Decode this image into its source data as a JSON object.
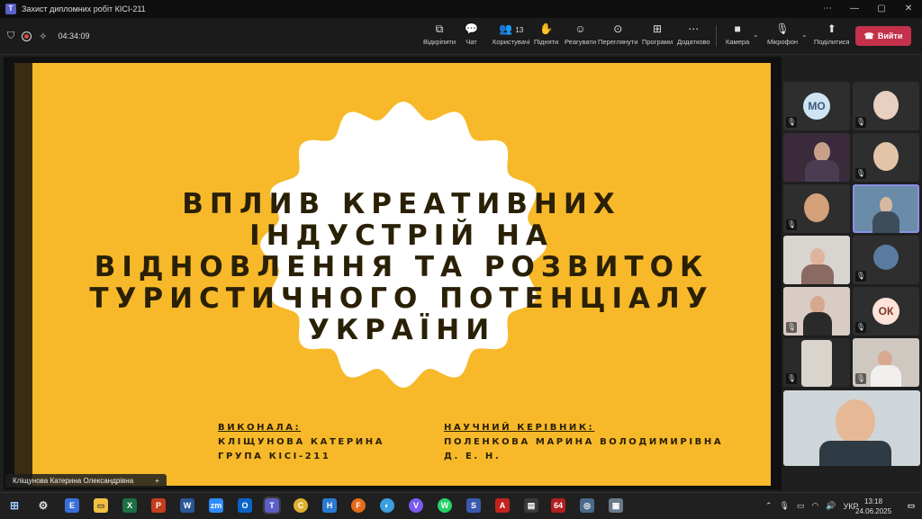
{
  "window": {
    "title": "Захист дипломних робіт КІСІ-211",
    "controls": [
      "⋯",
      "—",
      "▢",
      "✕"
    ]
  },
  "toolbar": {
    "timer": "04:34:09",
    "items": [
      {
        "label": "Відкріпити",
        "icon": "unpin-icon",
        "glyph": "⧉"
      },
      {
        "label": "Чат",
        "icon": "chat-icon",
        "glyph": "💬"
      },
      {
        "label": "Користувачі",
        "icon": "people-icon",
        "glyph": "👥",
        "count": "13"
      },
      {
        "label": "Підняти",
        "icon": "raise-hand-icon",
        "glyph": "✋"
      },
      {
        "label": "Реагувати",
        "icon": "react-icon",
        "glyph": "☺"
      },
      {
        "label": "Переглянути",
        "icon": "view-icon",
        "glyph": "⊙"
      },
      {
        "label": "Програми",
        "icon": "apps-icon",
        "glyph": "⊞"
      },
      {
        "label": "Додатково",
        "icon": "more-icon",
        "glyph": "⋯"
      }
    ],
    "camera_label": "Камера",
    "mic_label": "Мікрофон",
    "share_label": "Поділитися",
    "leave_label": "Вийти"
  },
  "slide": {
    "title_lines": [
      "ВПЛИВ КРЕАТИВНИХ",
      "ІНДУСТРІЙ НА",
      "ВІДНОВЛЕННЯ ТА РОЗВИТОК",
      "ТУРИСТИЧНОГО ПОТЕНЦІАЛУ",
      "УКРАЇНИ"
    ],
    "author_heading": "ВИКОНАЛА:",
    "author_name": "КЛІЩУНОВА КАТЕРИНА",
    "author_group": "ГРУПА КІСІ-211",
    "advisor_heading": "НАУЧНИЙ КЕРІВНИК:",
    "advisor_name": "ПОЛЕНКОВА МАРИНА ВОЛОДИМИРІВНА",
    "advisor_degree": "Д. Е. Н.",
    "bg_color": "#f7b92a"
  },
  "presenter": {
    "name": "Кліщунова Катерина Олександрівна",
    "pin": "+"
  },
  "participants": [
    {
      "initials": "МО",
      "avatar_color": "#cfe4f2",
      "text_color": "#3b5a7a"
    },
    {
      "initials": ""
    },
    {
      "initials": ""
    },
    {
      "initials": ""
    },
    {
      "initials": ""
    },
    {
      "initials": ""
    },
    {
      "initials": ""
    },
    {
      "initials": ""
    },
    {
      "initials": ""
    },
    {
      "initials": "ОК",
      "avatar_color": "#fde3d8",
      "text_color": "#7a3b2a"
    },
    {
      "initials": ""
    },
    {
      "initials": ""
    }
  ],
  "taskbar": {
    "apps": [
      "E",
      "W",
      "P",
      "X",
      "zm",
      "O",
      "T",
      "C",
      "H",
      "F",
      "V",
      "W",
      "S",
      "A",
      "64"
    ],
    "language": "УКР",
    "time": "13:18",
    "date": "24.06.2025"
  }
}
